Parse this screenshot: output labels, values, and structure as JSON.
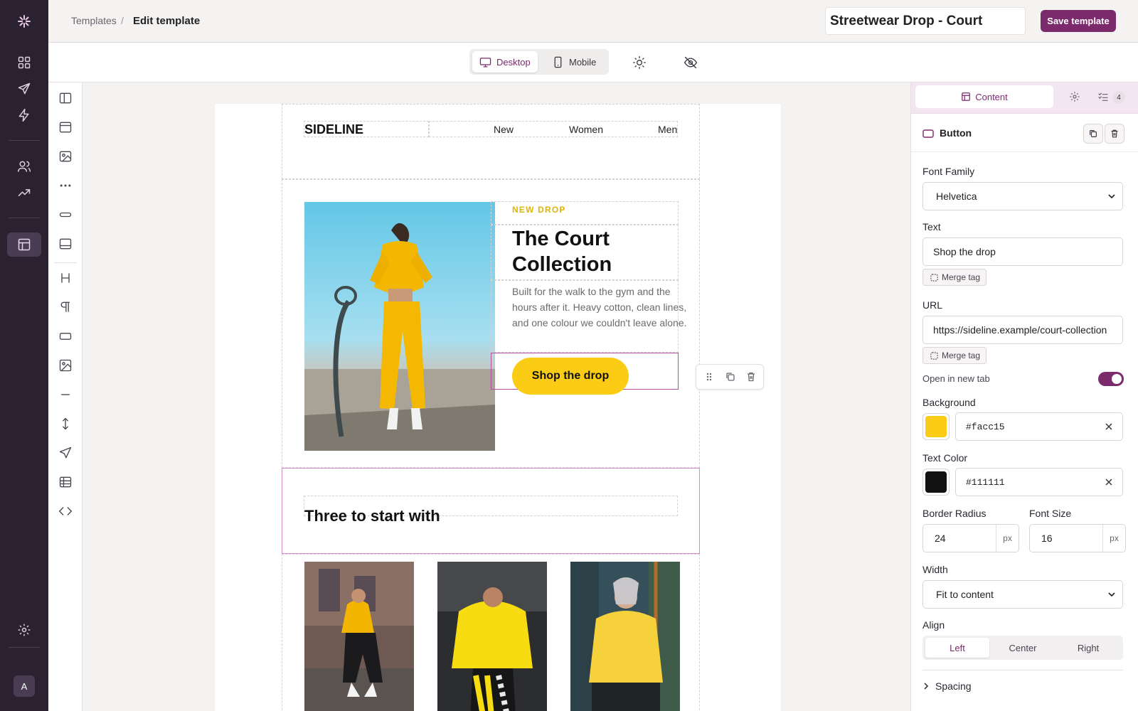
{
  "header": {
    "breadcrumb_parent": "Templates",
    "breadcrumb_separator": "/",
    "breadcrumb_current": "Edit template",
    "template_name": "Streetwear Drop - Court",
    "save_label": "Save template"
  },
  "toolbar": {
    "desktop_label": "Desktop",
    "mobile_label": "Mobile",
    "active_device": "Desktop"
  },
  "rail": {
    "avatar_initial": "A",
    "icons": [
      "grid-icon",
      "send-icon",
      "lightning-icon",
      "users-icon",
      "trending-icon",
      "templates-icon",
      "settings-icon"
    ]
  },
  "palette": {
    "icons": [
      "columns-icon",
      "section-icon",
      "image-block-icon",
      "more-icon",
      "button-block-icon",
      "footer-icon",
      "heading-icon",
      "paragraph-icon",
      "button-icon",
      "image-icon",
      "divider-icon",
      "spacer-icon",
      "social-icon",
      "table-icon",
      "html-icon"
    ]
  },
  "email": {
    "brand": "SIDELINE",
    "nav": [
      "New",
      "Women",
      "Men"
    ],
    "eyebrow": "NEW DROP",
    "headline": "The Court Collection",
    "body": "Built for the walk to the gym and the hours after it. Heavy cotton, clean lines, and one colour we couldn't leave alone.",
    "cta_label": "Shop the drop",
    "section_title": "Three to start with"
  },
  "panel": {
    "tab_content": "Content",
    "tab_badge": "4",
    "block_title": "Button",
    "font_family_label": "Font Family",
    "font_family_value": "Helvetica",
    "text_label": "Text",
    "text_value": "Shop the drop",
    "merge_tag_label": "Merge tag",
    "url_label": "URL",
    "url_value": "https://sideline.example/court-collection",
    "open_new_tab_label": "Open in new tab",
    "open_new_tab": true,
    "background_label": "Background",
    "background_value": "#facc15",
    "text_color_label": "Text Color",
    "text_color_value": "#111111",
    "border_radius_label": "Border Radius",
    "border_radius_value": "24",
    "font_size_label": "Font Size",
    "font_size_value": "16",
    "unit": "px",
    "width_label": "Width",
    "width_value": "Fit to content",
    "align_label": "Align",
    "align_options": [
      "Left",
      "Center",
      "Right"
    ],
    "align_selected": "Left",
    "spacing_label": "Spacing"
  },
  "colors": {
    "brand": "#7b2a6c",
    "rail": "#2a2230",
    "cta_background": "#facc15",
    "cta_text": "#111111",
    "eyebrow": "#e0b400"
  }
}
